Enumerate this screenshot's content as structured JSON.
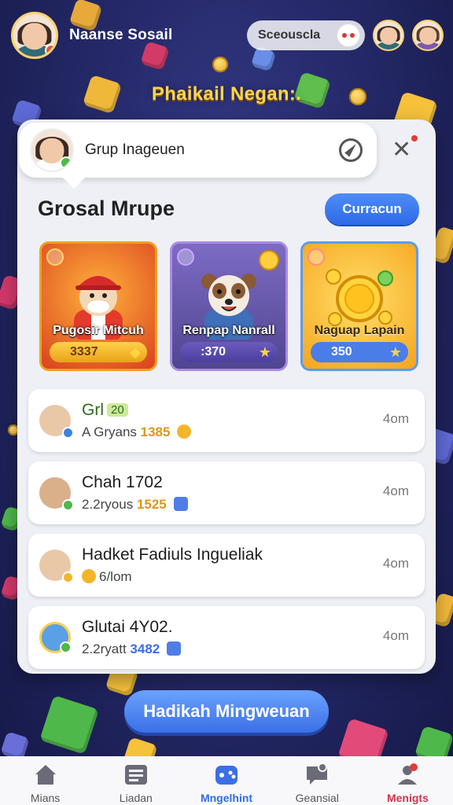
{
  "user": {
    "name": "Naanse Sosail"
  },
  "search": {
    "label": "Sceouscla"
  },
  "heading": "Phaikail Negan:.",
  "chat": {
    "text": "Grup Inageuen"
  },
  "section": {
    "title": "Grosal Mrupe",
    "button_label": "Curracun"
  },
  "tiles": [
    {
      "name": "Pugosir Mitcuh",
      "score": "3337"
    },
    {
      "name": "Renpap Nanrall",
      "score": ":370"
    },
    {
      "name": "Naguap Lapain",
      "score": "350"
    }
  ],
  "rows": [
    {
      "title": "Grl",
      "tag": "20",
      "sub_prefix": "A Gryans ",
      "sub_num": "1385",
      "time": "4om"
    },
    {
      "title": "Chah 1702",
      "tag": "",
      "sub_prefix": "2.2ryous ",
      "sub_num": "1525",
      "time": "4om"
    },
    {
      "title": "Hadket Fadiuls Ingueliak",
      "tag": "",
      "sub_prefix": "",
      "sub_num": "6/lom",
      "time": "4om"
    },
    {
      "title": "Glutai 4Y02.",
      "tag": "",
      "sub_prefix": "2.2ryatt ",
      "sub_num": "3482",
      "time": "4om"
    }
  ],
  "cta": {
    "label": "Hadikah Mingweuan"
  },
  "nav": [
    {
      "label": "Mians",
      "icon": "home-icon"
    },
    {
      "label": "Liadan",
      "icon": "list-icon"
    },
    {
      "label": "Mngelhint",
      "icon": "gamepad-icon"
    },
    {
      "label": "Geansial",
      "icon": "chat-icon"
    },
    {
      "label": "Menigts",
      "icon": "profile-icon"
    }
  ],
  "colors": {
    "accent": "#2e6cf0",
    "heading": "#ffd54d",
    "hot": "#d2354b"
  }
}
